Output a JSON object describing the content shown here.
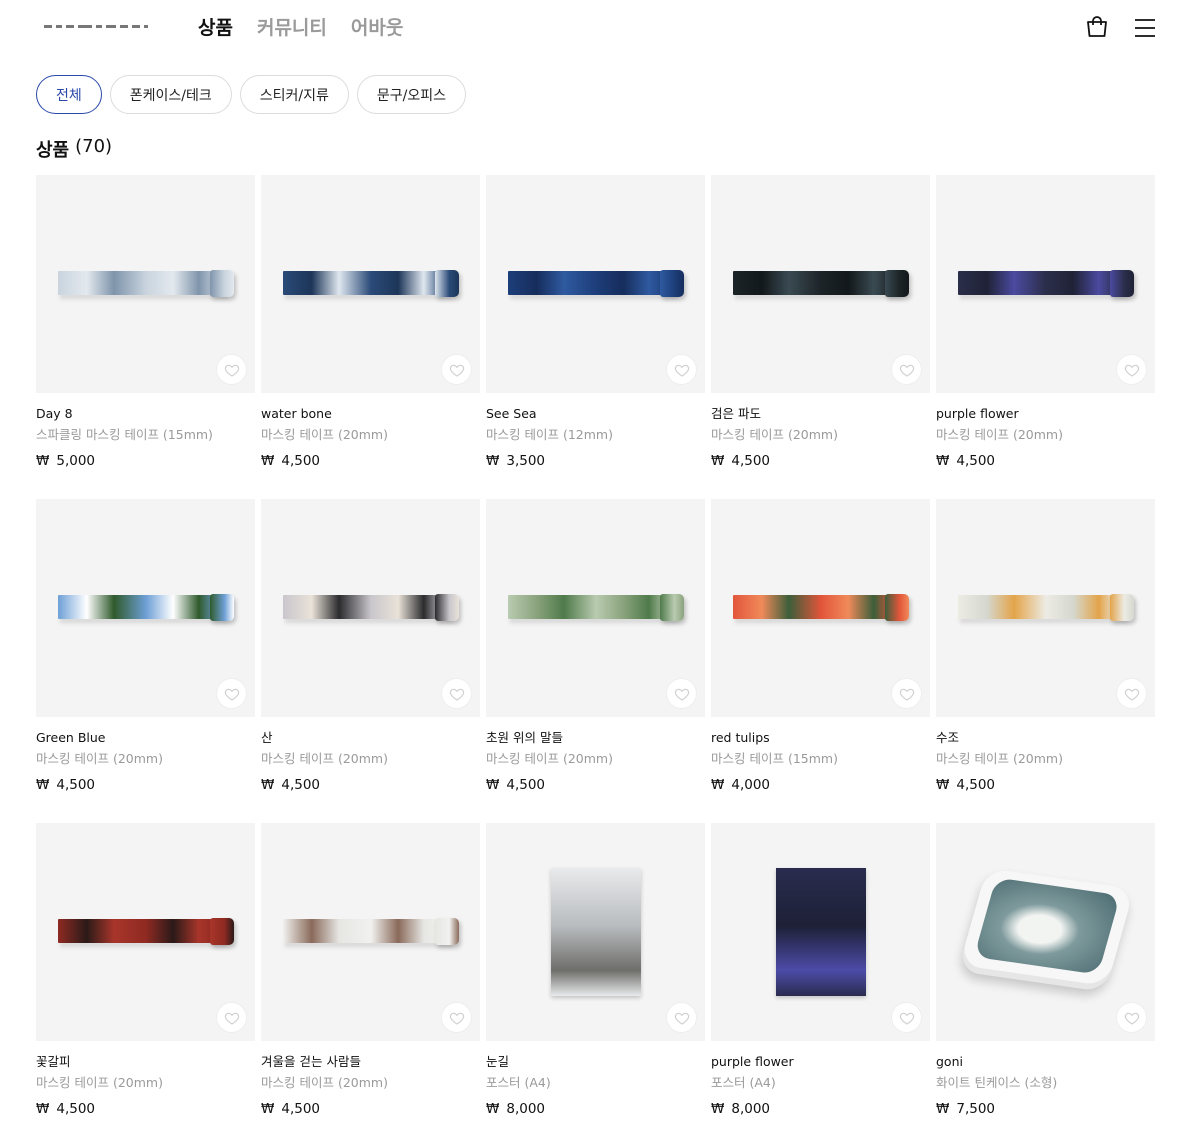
{
  "header": {
    "nav": [
      "상품",
      "커뮤니티",
      "어바웃"
    ],
    "active_nav": 0,
    "cart_icon": "shopping-bag-icon",
    "menu_icon": "hamburger-menu-icon"
  },
  "filters": {
    "items": [
      "전체",
      "폰케이스/테크",
      "스티커/지류",
      "문구/오피스"
    ],
    "active": 0
  },
  "section": {
    "title": "상품",
    "count": "(70)"
  },
  "currency": "₩",
  "products": [
    {
      "name": "Day 8",
      "sub": "스파클링 마스킹 테이프 (15mm)",
      "price": "5,000",
      "kind": "tape",
      "colors": [
        "#c9d4de",
        "#7f94ab",
        "#e3e9ee"
      ]
    },
    {
      "name": "water bone",
      "sub": "마스킹 테이프 (20mm)",
      "price": "4,500",
      "kind": "tape",
      "colors": [
        "#2a4a78",
        "#dfe7ef",
        "#1d3659"
      ]
    },
    {
      "name": "See Sea",
      "sub": "마스킹 테이프 (12mm)",
      "price": "3,500",
      "kind": "tape",
      "colors": [
        "#1d3e7a",
        "#2f5aa0",
        "#162d5c"
      ]
    },
    {
      "name": "검은 파도",
      "sub": "마스킹 테이프 (20mm)",
      "price": "4,500",
      "kind": "tape",
      "colors": [
        "#1c2428",
        "#3a4a52",
        "#12181b"
      ]
    },
    {
      "name": "purple flower",
      "sub": "마스킹 테이프 (20mm)",
      "price": "4,500",
      "kind": "tape",
      "colors": [
        "#2b2e4a",
        "#4b4aa0",
        "#1f2236"
      ]
    },
    {
      "name": "Green Blue",
      "sub": "마스킹 테이프 (20mm)",
      "price": "4,500",
      "kind": "tape",
      "colors": [
        "#6d9fd6",
        "#2f5a2c",
        "#ffffff"
      ]
    },
    {
      "name": "산",
      "sub": "마스킹 테이프 (20mm)",
      "price": "4,500",
      "kind": "tape",
      "colors": [
        "#c9c6cc",
        "#2b2b2e",
        "#e9e2d8"
      ]
    },
    {
      "name": "초원 위의 말들",
      "sub": "마스킹 테이프 (20mm)",
      "price": "4,500",
      "kind": "tape",
      "colors": [
        "#b9cbb0",
        "#4f7a4a",
        "#8aa37d"
      ]
    },
    {
      "name": "red tulips",
      "sub": "마스킹 테이프 (15mm)",
      "price": "4,000",
      "kind": "tape",
      "colors": [
        "#e2553a",
        "#3c5e3a",
        "#f08a5a"
      ]
    },
    {
      "name": "수조",
      "sub": "마스킹 테이프 (20mm)",
      "price": "4,500",
      "kind": "tape",
      "colors": [
        "#ecebe4",
        "#e3a44a",
        "#d5d8cf"
      ]
    },
    {
      "name": "꽃갈피",
      "sub": "마스킹 테이프 (20mm)",
      "price": "4,500",
      "kind": "tape",
      "colors": [
        "#8f2a22",
        "#a8352a",
        "#2b1a18"
      ]
    },
    {
      "name": "겨울을 걷는 사람들",
      "sub": "마스킹 테이프 (20mm)",
      "price": "4,500",
      "kind": "tape",
      "colors": [
        "#f1f1ef",
        "#e6e6e3",
        "#8a6a5a"
      ]
    },
    {
      "name": "눈길",
      "sub": "포스터 (A4)",
      "price": "8,000",
      "kind": "poster",
      "colors": [
        "#e8eaec",
        "#6e6e6a",
        "#b9bcbf"
      ]
    },
    {
      "name": "purple flower",
      "sub": "포스터 (A4)",
      "price": "8,000",
      "kind": "poster",
      "colors": [
        "#2a2c4f",
        "#4c4ba8",
        "#1d2036"
      ]
    },
    {
      "name": "goni",
      "sub": "화이트 틴케이스 (소형)",
      "price": "7,500",
      "kind": "tin",
      "colors": [
        "#4a6a70",
        "#f2f4f2",
        "#7e9a9c"
      ]
    }
  ]
}
